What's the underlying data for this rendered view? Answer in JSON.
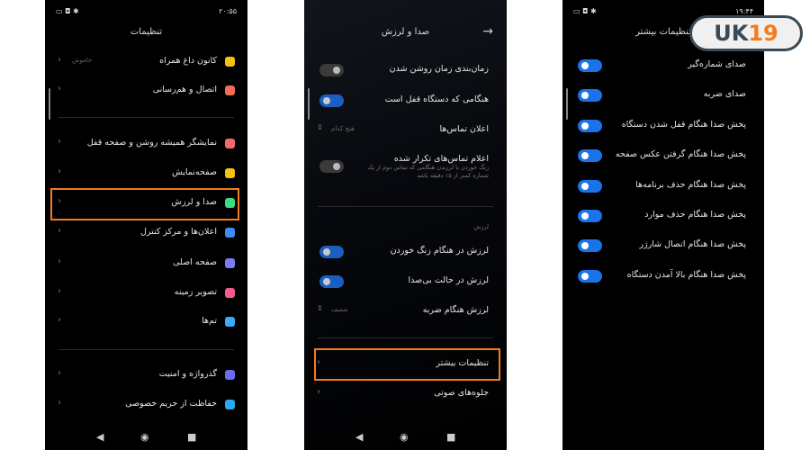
{
  "colors": {
    "highlight": "#f47b20",
    "toggle_on": "#1a73e8",
    "toggle_off": "#3a3a3a"
  },
  "logo": {
    "text_a": "UK",
    "text_b": "19"
  },
  "panel1": {
    "status_time": "۲۰:۵۵",
    "title": "تنظیمات",
    "items": [
      {
        "label": "کانون داغ همراه",
        "value": "خاموش",
        "icon": "hotspot-icon",
        "color": "#f4c20d"
      },
      {
        "label": "اتصال و هم‌رسانی",
        "icon": "connection-icon",
        "color": "#f26b5b"
      },
      {
        "label": "نمایشگر همیشه روشن و صفحه قفل",
        "icon": "lock-icon",
        "color": "#f26b6b"
      },
      {
        "label": "صفحه‌نمایش",
        "icon": "sun-icon",
        "color": "#f4c20d"
      },
      {
        "label": "صدا و لرزش",
        "icon": "speaker-icon",
        "color": "#3ddc84"
      },
      {
        "label": "اعلان‌ها و مرکز کنترل",
        "icon": "notification-icon",
        "color": "#3a8ef6"
      },
      {
        "label": "صفحه اصلی",
        "icon": "home-icon",
        "color": "#7b7bf5"
      },
      {
        "label": "تصویر زمینه",
        "icon": "tulip-icon",
        "color": "#f25c8a"
      },
      {
        "label": "تم‌ها",
        "icon": "brush-icon",
        "color": "#3aaaf6"
      },
      {
        "label": "گذرواژه و امنیت",
        "icon": "fingerprint-icon",
        "color": "#6b6bf5"
      },
      {
        "label": "حفاظت از حریم خصوصی",
        "icon": "privacy-icon",
        "color": "#2aa8f2"
      }
    ]
  },
  "panel2": {
    "title": "صدا و لرزش",
    "back_icon": "arrow-right-icon",
    "items": [
      {
        "label": "زمان‌بندی زمان روشن شدن",
        "toggle": false
      },
      {
        "label": "هنگامی که دستگاه قفل است",
        "toggle": true
      },
      {
        "label": "اعلان تماس‌ها",
        "value": "هیچ کدام"
      },
      {
        "label": "اعلام تماس‌های تکرار شده",
        "sub": "زنگ خوردن یا لرزیدن هنگامی که تماس دوم از یک شماره کمتر از ۱۵ دقیقه باشد",
        "toggle": false
      },
      {
        "label": "لرزش در هنگام زنگ خوردن",
        "toggle": true
      },
      {
        "label": "لرزش در حالت بی‌صدا",
        "toggle": true
      },
      {
        "label": "لرزش هنگام ضربه",
        "value": "ضعیف"
      },
      {
        "label": "تنظیمات بیشتر"
      },
      {
        "label": "جلوه‌های صوتی"
      }
    ],
    "section_label": "لرزش"
  },
  "panel3": {
    "status_time": "۱۹:۴۴",
    "title": "تنظیمات بیشتر",
    "items": [
      {
        "label": "صدای شماره‌گیر",
        "toggle": true
      },
      {
        "label": "صدای ضربه",
        "toggle": true
      },
      {
        "label": "پخش صدا هنگام قفل شدن دستگاه",
        "toggle": true
      },
      {
        "label": "پخش صدا هنگام گرفتن عکس صفحه",
        "toggle": true
      },
      {
        "label": "پخش صدا هنگام حذف برنامه‌ها",
        "toggle": true
      },
      {
        "label": "پخش صدا هنگام حذف موارد",
        "toggle": true
      },
      {
        "label": "پخش صدا هنگام اتصال شارژر",
        "toggle": true
      },
      {
        "label": "پخش صدا هنگام بالا آمدن دستگاه",
        "toggle": true
      }
    ]
  }
}
